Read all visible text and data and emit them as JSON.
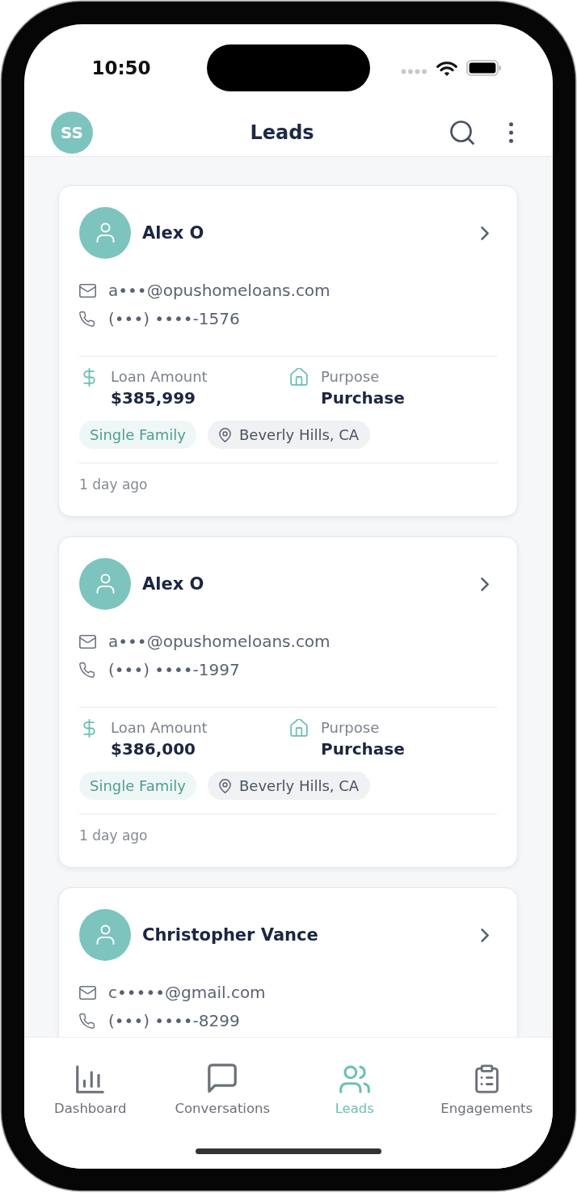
{
  "status_bar": {
    "time": "10:50"
  },
  "header": {
    "avatar_initials": "SS",
    "title": "Leads"
  },
  "leads": [
    {
      "name": "Alex O",
      "email": "a•••@opushomeloans.com",
      "phone": "(•••) ••••-1576",
      "loan_amount_label": "Loan Amount",
      "loan_amount": "$385,999",
      "purpose_label": "Purpose",
      "purpose": "Purchase",
      "property_type": "Single Family",
      "location": "Beverly Hills, CA",
      "age": "1 day ago"
    },
    {
      "name": "Alex O",
      "email": "a•••@opushomeloans.com",
      "phone": "(•••) ••••-1997",
      "loan_amount_label": "Loan Amount",
      "loan_amount": "$386,000",
      "purpose_label": "Purpose",
      "purpose": "Purchase",
      "property_type": "Single Family",
      "location": "Beverly Hills, CA",
      "age": "1 day ago"
    },
    {
      "name": "Christopher Vance",
      "email": "c•••••@gmail.com",
      "phone": "(•••) ••••-8299"
    }
  ],
  "tab_bar": [
    {
      "label": "Dashboard",
      "selected": false
    },
    {
      "label": "Conversations",
      "selected": false
    },
    {
      "label": "Leads",
      "selected": true
    },
    {
      "label": "Engagements",
      "selected": false
    }
  ]
}
